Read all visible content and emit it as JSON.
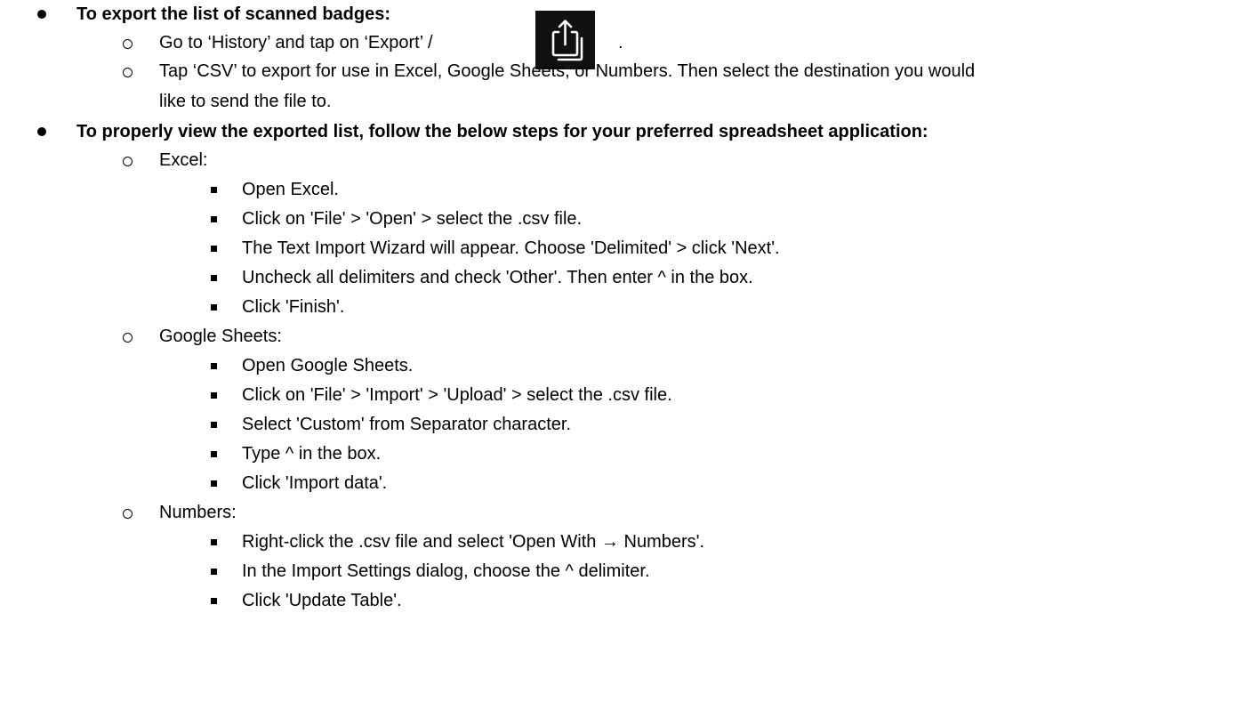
{
  "sections": [
    {
      "heading": "To export the list of scanned badges:",
      "steps": [
        {
          "before_icon": "Go to ‘History’ and tap on ‘Export’ /",
          "after_icon": "."
        },
        {
          "line1": "Tap ‘CSV’ to export for use in Excel, Google Sheets, or Numbers. Then select the destination you would",
          "line2": "like to send the file to."
        }
      ]
    },
    {
      "heading": "To properly view the exported list, follow the below steps for your preferred spreadsheet application:",
      "apps": [
        {
          "name": "Excel:",
          "steps": [
            "Open Excel.",
            "Click on 'File' > 'Open' > select the .csv file.",
            "The Text Import Wizard will appear. Choose 'Delimited' > click 'Next'.",
            "Uncheck all delimiters and check 'Other'. Then enter ^ in the box.",
            "Click 'Finish'."
          ]
        },
        {
          "name": "Google Sheets:",
          "steps": [
            "Open Google Sheets.",
            "Click on 'File' > 'Import' > 'Upload' > select the .csv file.",
            "Select 'Custom' from Separator character.",
            "Type ^ in the box.",
            "Click 'Import data'."
          ]
        },
        {
          "name": "Numbers:",
          "steps": [
            "Right-click the .csv file and select 'Open With → Numbers'.",
            "In the Import Settings dialog, choose the ^ delimiter.",
            "Click 'Update Table'."
          ]
        }
      ]
    }
  ],
  "icons": {
    "export": "share-export-icon"
  }
}
